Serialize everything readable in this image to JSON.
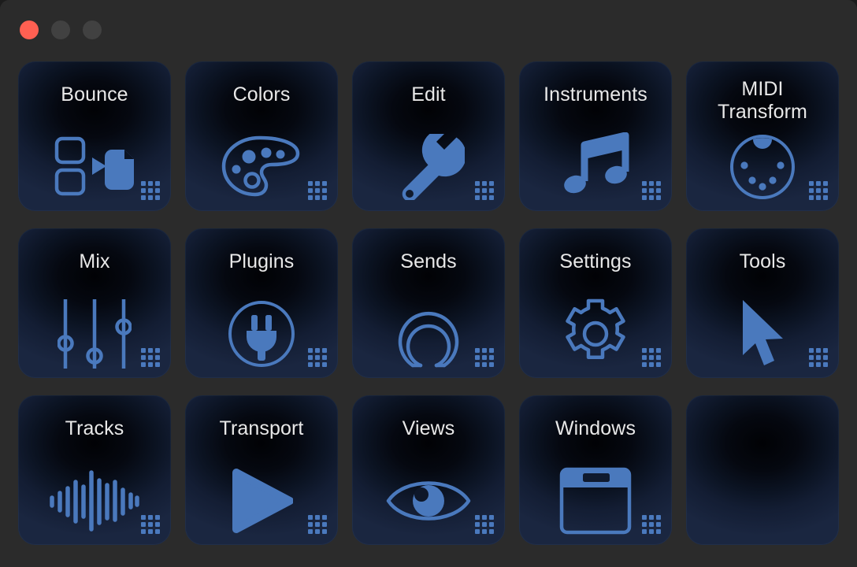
{
  "window": {
    "controls": [
      {
        "name": "close",
        "label": "Close",
        "color": "#ff6052"
      },
      {
        "name": "minimize",
        "label": "Minimize",
        "color": "#414141"
      },
      {
        "name": "zoom",
        "label": "Zoom",
        "color": "#414141"
      }
    ],
    "background_color": "#2b2b2b"
  },
  "theme": {
    "card_accent": "#4a79bd",
    "card_title_color": "#e8e8e8",
    "card_background_outer": "#1a2640",
    "card_background_inner": "#010205"
  },
  "grid": {
    "columns": 5,
    "rows": 3,
    "badge_icon": "grid-dots-icon",
    "cards": [
      {
        "id": "bounce",
        "label": "Bounce",
        "icon": "bounce-icon",
        "empty": false
      },
      {
        "id": "colors",
        "label": "Colors",
        "icon": "palette-icon",
        "empty": false
      },
      {
        "id": "edit",
        "label": "Edit",
        "icon": "wrench-icon",
        "empty": false
      },
      {
        "id": "instruments",
        "label": "Instruments",
        "icon": "music-note-icon",
        "empty": false
      },
      {
        "id": "midi-transform",
        "label": "MIDI\nTransform",
        "icon": "midi-port-icon",
        "empty": false
      },
      {
        "id": "mix",
        "label": "Mix",
        "icon": "faders-icon",
        "empty": false
      },
      {
        "id": "plugins",
        "label": "Plugins",
        "icon": "plug-icon",
        "empty": false
      },
      {
        "id": "sends",
        "label": "Sends",
        "icon": "send-arc-icon",
        "empty": false
      },
      {
        "id": "settings",
        "label": "Settings",
        "icon": "gear-icon",
        "empty": false
      },
      {
        "id": "tools",
        "label": "Tools",
        "icon": "cursor-arrow-icon",
        "empty": false
      },
      {
        "id": "tracks",
        "label": "Tracks",
        "icon": "waveform-icon",
        "empty": false
      },
      {
        "id": "transport",
        "label": "Transport",
        "icon": "play-icon",
        "empty": false
      },
      {
        "id": "views",
        "label": "Views",
        "icon": "eye-icon",
        "empty": false
      },
      {
        "id": "windows",
        "label": "Windows",
        "icon": "window-icon",
        "empty": false
      },
      {
        "id": "empty-slot",
        "label": "",
        "icon": "",
        "empty": true
      }
    ]
  }
}
